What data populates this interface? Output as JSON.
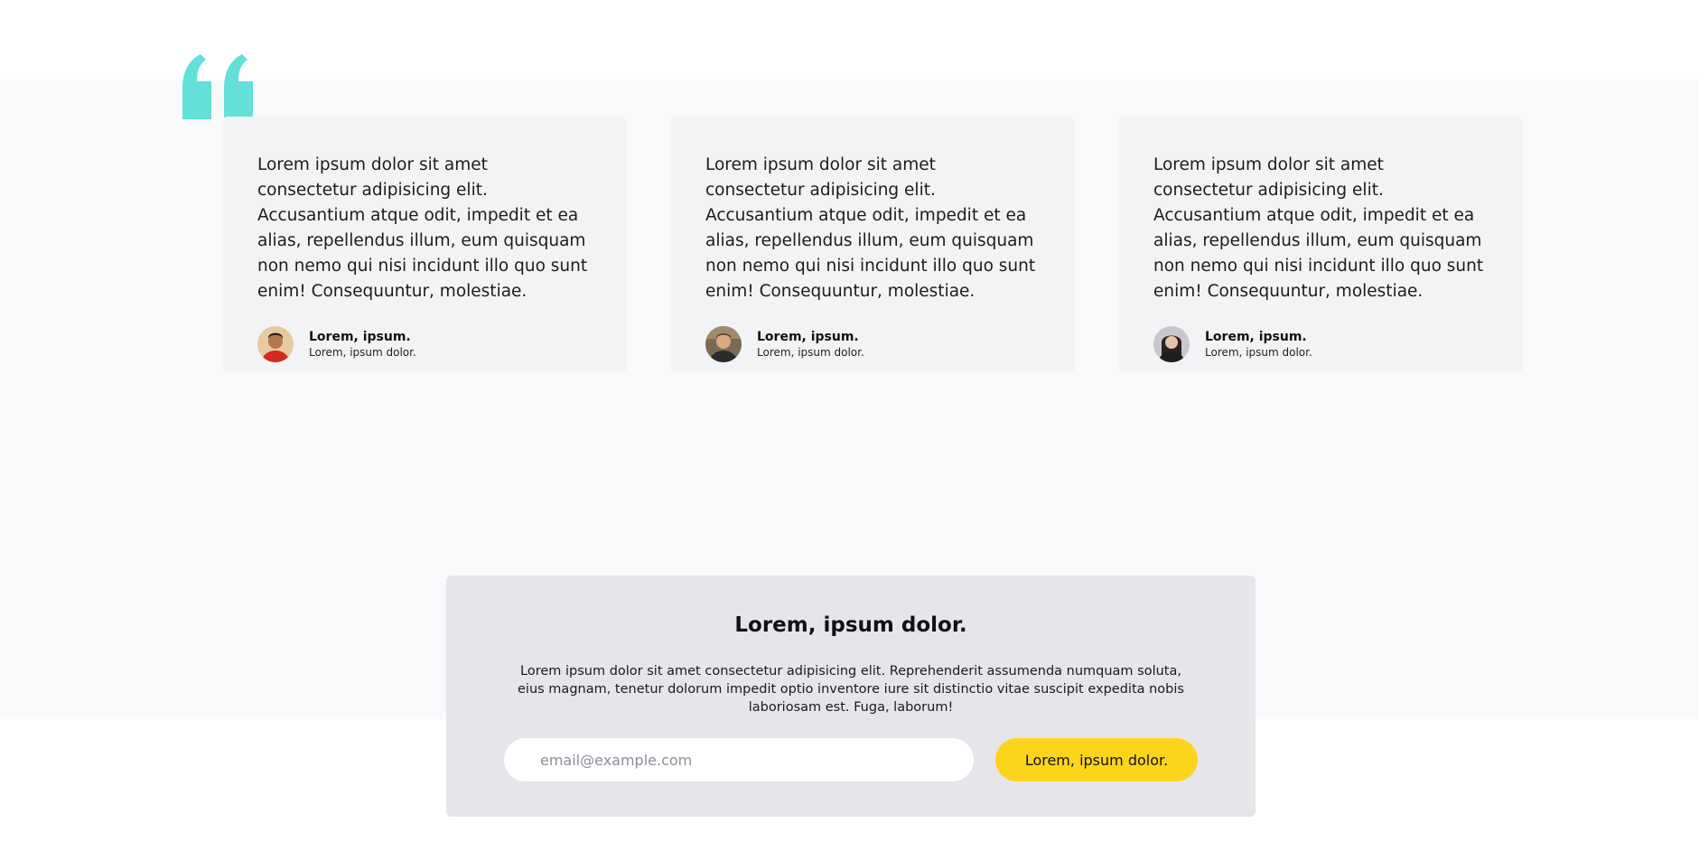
{
  "colors": {
    "band_background": "#f8f9fa",
    "card_background": "#f2f3f5",
    "quote_accent": "#62e0d9",
    "newsletter_background": "#e5e6e9",
    "button_accent": "#fdd41c"
  },
  "quote_icon": "quote-mark-icon",
  "testimonials": [
    {
      "text": "Lorem ipsum dolor sit amet consectetur adipisicing elit. Accusantium atque odit, impedit et ea alias, repellendus illum, eum quisquam non nemo qui nisi incidunt illo quo sunt enim! Consequuntur, molestiae.",
      "name": "Lorem, ipsum.",
      "role": "Lorem, ipsum dolor."
    },
    {
      "text": "Lorem ipsum dolor sit amet consectetur adipisicing elit. Accusantium atque odit, impedit et ea alias, repellendus illum, eum quisquam non nemo qui nisi incidunt illo quo sunt enim! Consequuntur, molestiae.",
      "name": "Lorem, ipsum.",
      "role": "Lorem, ipsum dolor."
    },
    {
      "text": "Lorem ipsum dolor sit amet consectetur adipisicing elit. Accusantium atque odit, impedit et ea alias, repellendus illum, eum quisquam non nemo qui nisi incidunt illo quo sunt enim! Consequuntur, molestiae.",
      "name": "Lorem, ipsum.",
      "role": "Lorem, ipsum dolor."
    }
  ],
  "newsletter": {
    "title": "Lorem, ipsum dolor.",
    "description": "Lorem ipsum dolor sit amet consectetur adipisicing elit. Reprehenderit assumenda numquam soluta, eius magnam, tenetur dolorum impedit optio inventore iure sit distinctio vitae suscipit expedita nobis laboriosam est. Fuga, laborum!",
    "email_placeholder": "email@example.com",
    "email_value": "",
    "button_label": "Lorem, ipsum dolor."
  }
}
